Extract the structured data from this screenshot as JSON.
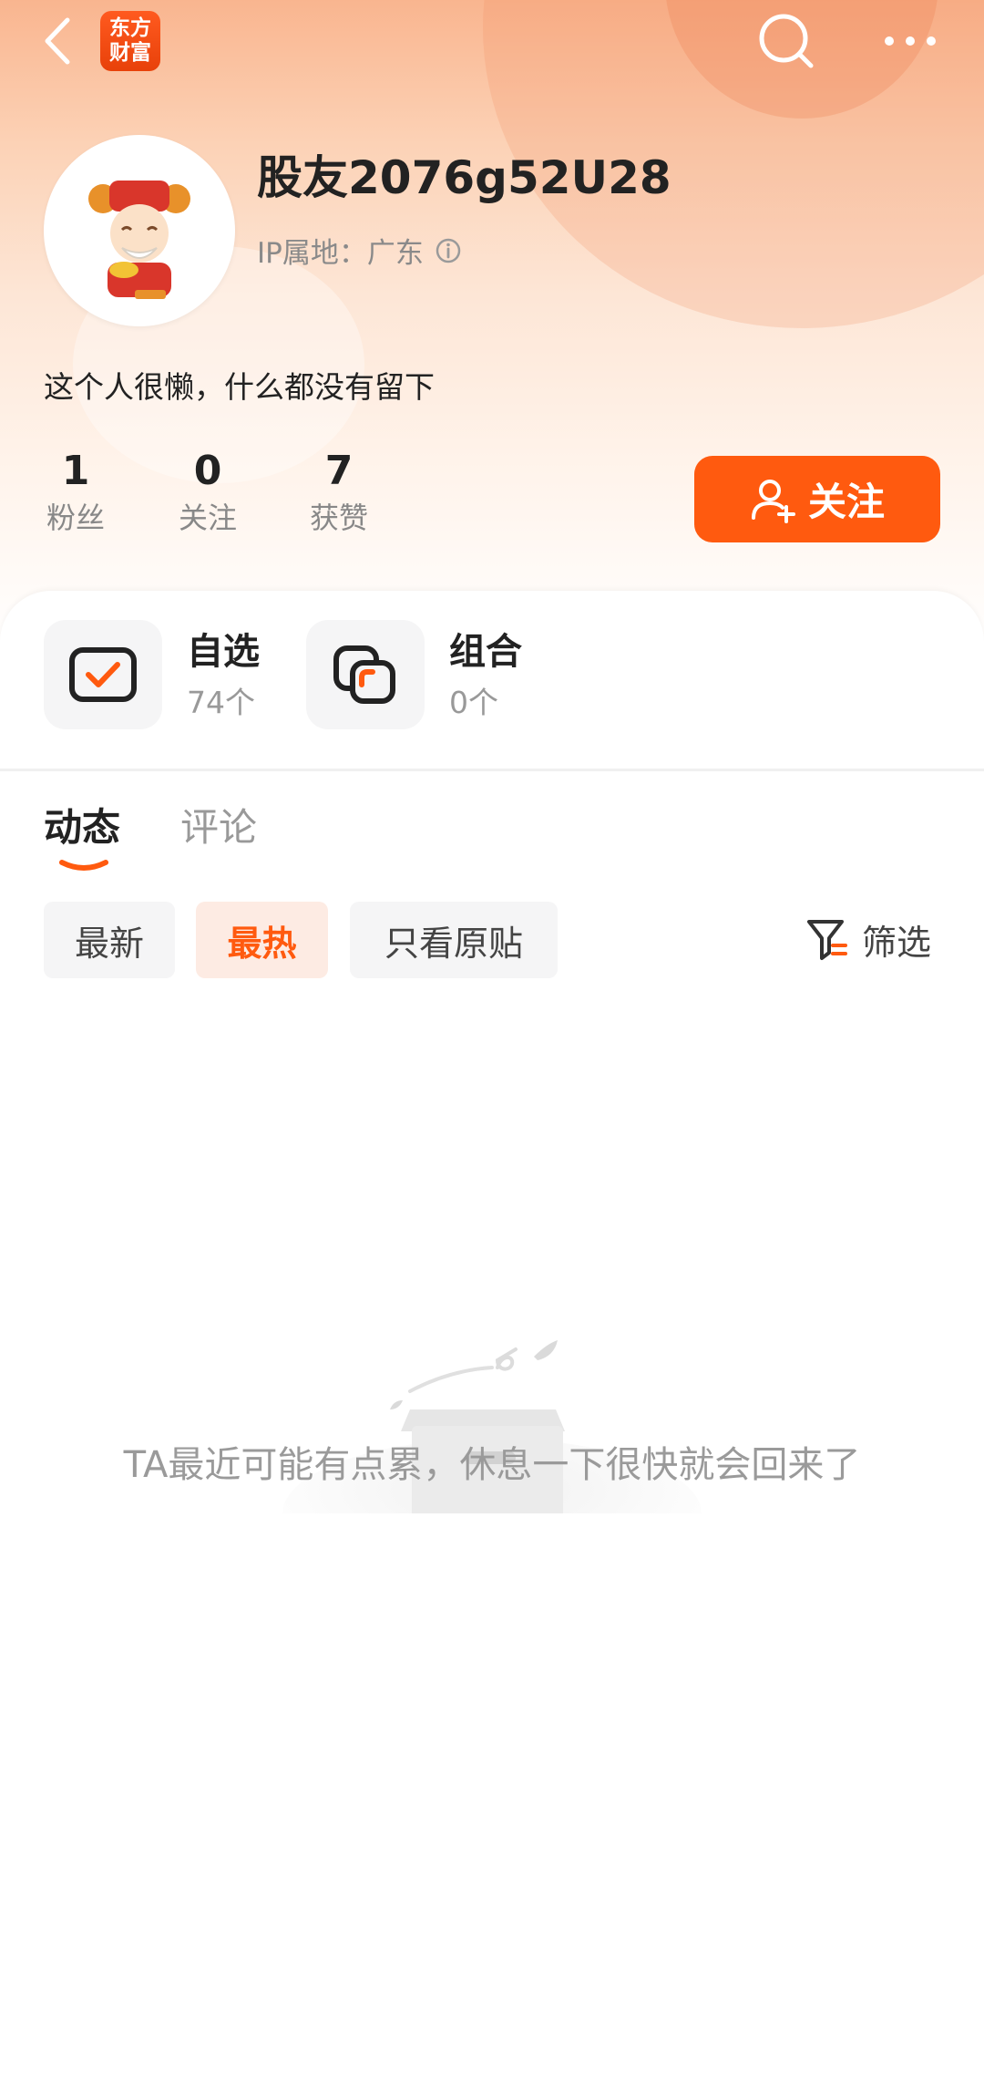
{
  "app": {
    "logo_line1": "东方",
    "logo_line2": "财富"
  },
  "profile": {
    "username": "股友2076g52U28",
    "ip_label": "IP属地：广东",
    "bio": "这个人很懒，什么都没有留下"
  },
  "stats": [
    {
      "value": "1",
      "label": "粉丝"
    },
    {
      "value": "0",
      "label": "关注"
    },
    {
      "value": "7",
      "label": "获赞"
    }
  ],
  "follow_button": {
    "label": "关注"
  },
  "quick_links": [
    {
      "title": "自选",
      "subtitle": "74个"
    },
    {
      "title": "组合",
      "subtitle": "0个"
    }
  ],
  "tabs": [
    {
      "label": "动态",
      "active": true
    },
    {
      "label": "评论",
      "active": false
    }
  ],
  "sort_chips": [
    {
      "label": "最新",
      "selected": false
    },
    {
      "label": "最热",
      "selected": true
    },
    {
      "label": "只看原贴",
      "selected": false
    }
  ],
  "filter": {
    "label": "筛选"
  },
  "empty_state": {
    "text": "TA最近可能有点累，休息一下很快就会回来了"
  },
  "colors": {
    "accent": "#ff5a0f",
    "chip_selected_bg": "#fdebe3",
    "muted_text": "#999999"
  },
  "icons": {
    "back": "chevron-left-icon",
    "search": "search-icon",
    "more": "more-dots-icon",
    "info": "info-icon",
    "add_user": "add-user-icon",
    "watchlist": "checkbox-icon",
    "portfolio": "portfolio-icon",
    "filter": "filter-icon",
    "empty": "empty-box-icon"
  }
}
